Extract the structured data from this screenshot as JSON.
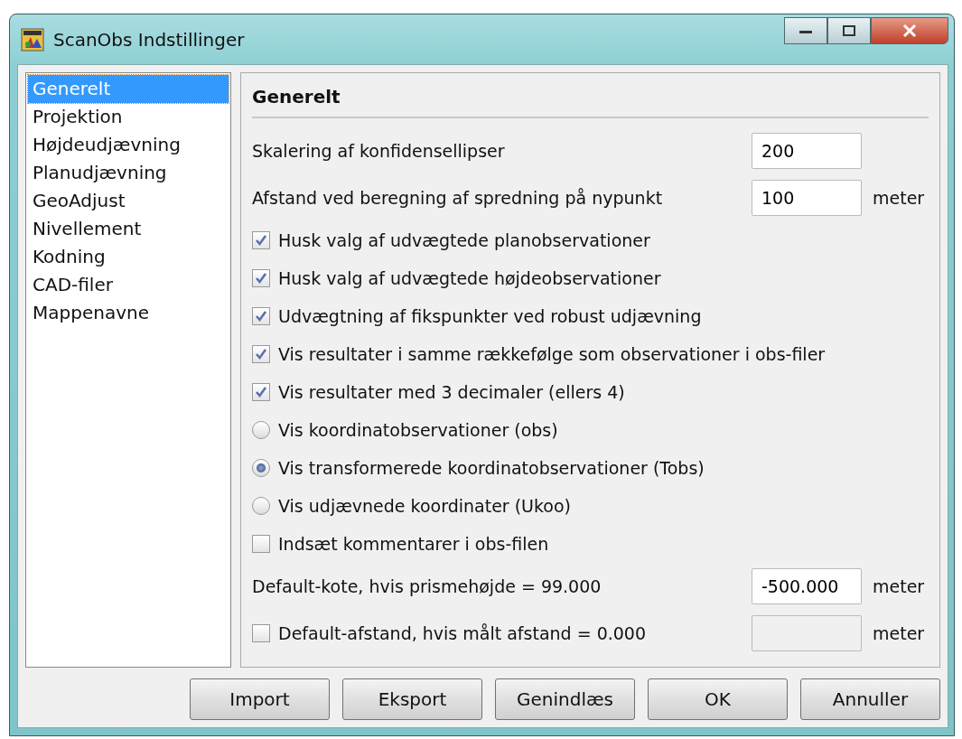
{
  "window": {
    "title": "ScanObs Indstillinger"
  },
  "sidebar": {
    "items": [
      {
        "label": "Generelt",
        "selected": true
      },
      {
        "label": "Projektion",
        "selected": false
      },
      {
        "label": "Højdeudjævning",
        "selected": false
      },
      {
        "label": "Planudjævning",
        "selected": false
      },
      {
        "label": "GeoAdjust",
        "selected": false
      },
      {
        "label": "Nivellement",
        "selected": false
      },
      {
        "label": "Kodning",
        "selected": false
      },
      {
        "label": "CAD-filer",
        "selected": false
      },
      {
        "label": "Mappenavne",
        "selected": false
      }
    ]
  },
  "panel": {
    "heading": "Generelt",
    "rows": [
      {
        "kind": "field",
        "label": "Skalering af konfidensellipser",
        "value": "200"
      },
      {
        "kind": "field",
        "label": "Afstand ved beregning af spredning på nypunkt",
        "value": "100",
        "unit": "meter"
      },
      {
        "kind": "checkbox",
        "label": "Husk valg af udvægtede planobservationer",
        "checked": true
      },
      {
        "kind": "checkbox",
        "label": "Husk valg af udvægtede højdeobservationer",
        "checked": true
      },
      {
        "kind": "checkbox",
        "label": "Udvægtning af fikspunkter ved robust udjævning",
        "checked": true
      },
      {
        "kind": "checkbox",
        "label": "Vis resultater i samme rækkefølge som observationer i obs-filer",
        "checked": true
      },
      {
        "kind": "checkbox",
        "label": "Vis resultater med 3 decimaler (ellers 4)",
        "checked": true
      },
      {
        "kind": "radio",
        "label": "Vis koordinatobservationer (obs)",
        "selected": false
      },
      {
        "kind": "radio",
        "label": "Vis transformerede koordinatobservationer (Tobs)",
        "selected": true
      },
      {
        "kind": "radio",
        "label": "Vis udjævnede koordinater (Ukoo)",
        "selected": false
      },
      {
        "kind": "checkbox",
        "label": "Indsæt kommentarer i obs-filen",
        "checked": false
      },
      {
        "kind": "field",
        "label": "Default-kote, hvis prismehøjde = 99.000",
        "value": "-500.000",
        "unit": "meter"
      },
      {
        "kind": "checkfield",
        "label": "Default-afstand, hvis målt afstand = 0.000",
        "checked": false,
        "disabled": true,
        "unit": "meter"
      }
    ]
  },
  "buttons": [
    "Import",
    "Eksport",
    "Genindlæs",
    "OK",
    "Annuller"
  ]
}
